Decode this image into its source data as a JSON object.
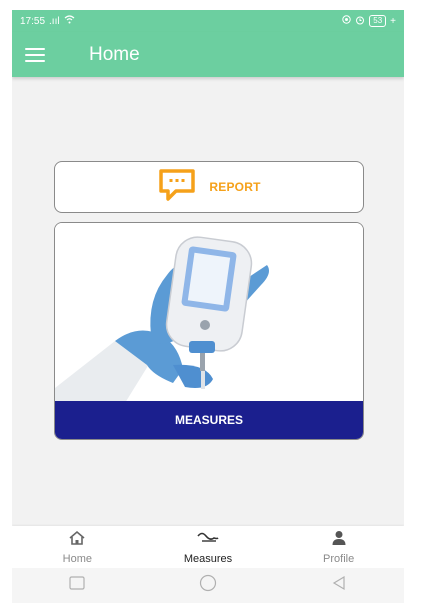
{
  "status_bar": {
    "time": "17:55",
    "signal": ".ııl",
    "battery": "53"
  },
  "app_bar": {
    "title": "Home",
    "menu_icon": "hamburger-menu-icon"
  },
  "cards": {
    "report": {
      "label": "REPORT",
      "icon": "chat-bubble-icon",
      "color": "#f5a11a"
    },
    "measures": {
      "label": "MEASURES",
      "image": "glucose-meter-in-gloved-hands",
      "band_color": "#1b1f8e"
    }
  },
  "bottom_nav": {
    "items": [
      {
        "label": "Home",
        "icon": "home-icon",
        "active": false
      },
      {
        "label": "Measures",
        "icon": "wave-icon",
        "active": true
      },
      {
        "label": "Profile",
        "icon": "person-icon",
        "active": false
      }
    ]
  },
  "system_nav": {
    "icons": [
      "square-icon",
      "circle-icon",
      "back-triangle-icon"
    ]
  },
  "colors": {
    "accent": "#6ccfa0",
    "report": "#f5a11a",
    "measures_band": "#1b1f8e",
    "background": "#f2f2f2"
  }
}
